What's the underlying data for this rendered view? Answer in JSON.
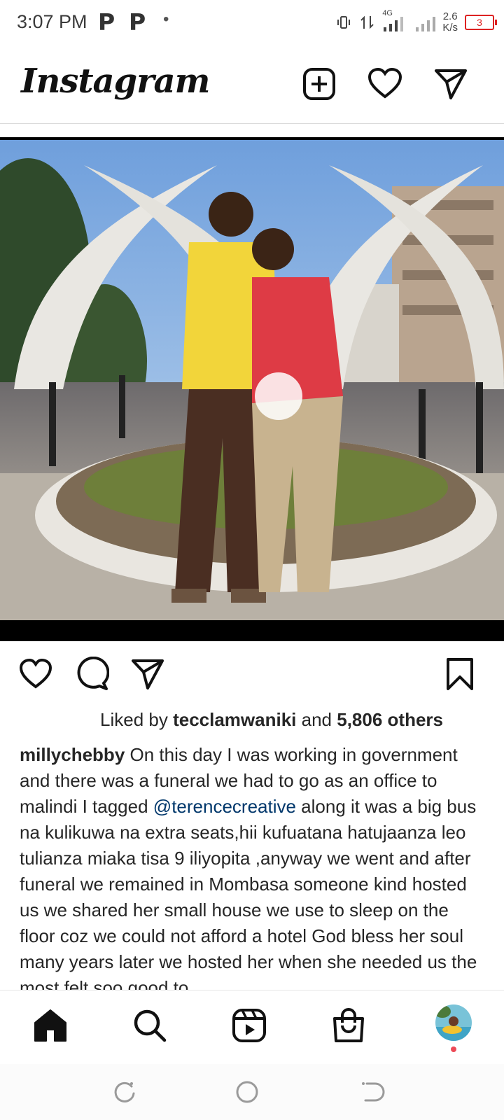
{
  "status_bar": {
    "time": "3:07 PM",
    "app_glyph_1": "P",
    "app_glyph_2": "P",
    "dot": "•",
    "network": "4G",
    "speed_value": "2.6",
    "speed_unit": "K/s",
    "battery": "3"
  },
  "header": {
    "logo": "Instagram",
    "icons": [
      "new-post-icon",
      "heart-icon",
      "direct-message-icon"
    ]
  },
  "post": {
    "liked_by_prefix": "Liked by",
    "liked_by_user": "tecclamwaniki",
    "liked_by_and": "and",
    "liked_by_others": "5,806 others",
    "caption_user": "millychebby",
    "caption_part1": " On this day I was working in government and there was a funeral we had to go as an office to malindi I tagged ",
    "caption_mention": "@terencecreative",
    "caption_part2": " along it was a big bus na kulikuwa na extra seats,hii kufuatana hatujaanza leo tulianza miaka tisa 9 iliyopita ,anyway we went and after funeral we remained in Mombasa someone kind hosted us we shared her small house we use to sleep on the floor coz we could not afford a hotel God bless her soul many years later we hosted her when she needed us the most felt soo good to"
  },
  "bottom_nav": [
    "home-icon",
    "search-icon",
    "reels-icon",
    "shop-icon",
    "profile-avatar"
  ],
  "colors": {
    "mention": "#00376b",
    "notification": "#ed4956"
  }
}
